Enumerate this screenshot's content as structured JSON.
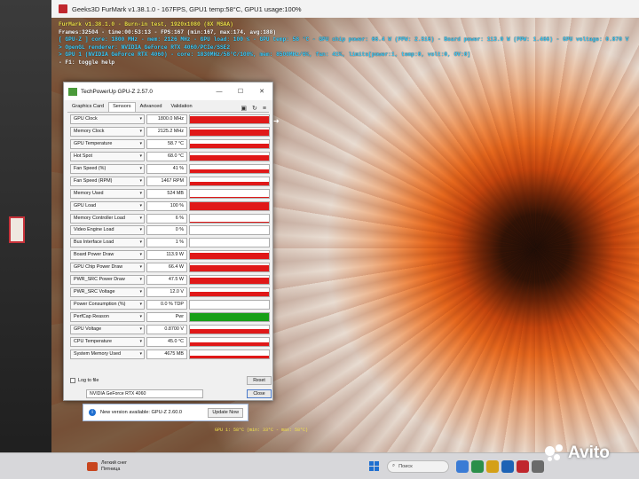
{
  "furmark_window": {
    "title": "Geeks3D FurMark v1.38.1.0 - 167FPS, GPU1 temp:58°C, GPU1 usage:100%"
  },
  "osd": {
    "lines": [
      "FurMark v1.38.1.0 - Burn-in test, 1920x1080 (8X MSAA)",
      "Frames:32504 - time:00:53:13 - FPS:167 (min:167, max:174, avg:188)",
      "[ GPU-Z ] core: 1800 MHz - mem: 2126 MHz - GPU load: 100 % - GPU temp: 58 °C - GPU chip power: 66.4 W (PPW: 2.516) - Board power: 113.9 W (PPW: 1.466) - GPU voltage: 0.870 V",
      "> OpenGL renderer: NVIDIA GeForce RTX 4060/PCIe/SSE2",
      "> GPU 1 (NVIDIA GeForce RTX 4060) - core: 1830MHz/58°C/100%, mem: 8500MHz/6%, fan: 41%, limits[power:1, temp:0, volt:0, OV:0]",
      "- F1: toggle help"
    ],
    "status": "GPU 1: 58°C (min: 33°C - max: 58°C)"
  },
  "gpuz": {
    "title": "TechPowerUp GPU-Z 2.57.0",
    "tabs": [
      "Graphics Card",
      "Sensors",
      "Advanced",
      "Validation"
    ],
    "active_tab": "Sensors",
    "sensors": [
      {
        "label": "GPU Clock",
        "value": "1800.0 MHz",
        "level": 0.85,
        "color": "#e01818"
      },
      {
        "label": "Memory Clock",
        "value": "2125.2 MHz",
        "level": 0.75,
        "color": "#e01818"
      },
      {
        "label": "GPU Temperature",
        "value": "58.7 °C",
        "level": 0.55,
        "color": "#e01818"
      },
      {
        "label": "Hot Spot",
        "value": "68.0 °C",
        "level": 0.6,
        "color": "#e01818"
      },
      {
        "label": "Fan Speed (%)",
        "value": "41 %",
        "level": 0.4,
        "color": "#e01818"
      },
      {
        "label": "Fan Speed (RPM)",
        "value": "1467 RPM",
        "level": 0.4,
        "color": "#e01818"
      },
      {
        "label": "Memory Used",
        "value": "524 MB",
        "level": 0.06,
        "color": "#e01818"
      },
      {
        "label": "GPU Load",
        "value": "100 %",
        "level": 1.0,
        "color": "#e01818"
      },
      {
        "label": "Memory Controller Load",
        "value": "6 %",
        "level": 0.08,
        "color": "#e01818"
      },
      {
        "label": "Video Engine Load",
        "value": "0 %",
        "level": 0.0,
        "color": "#e01818"
      },
      {
        "label": "Bus Interface Load",
        "value": "1 %",
        "level": 0.05,
        "color": "#e01818"
      },
      {
        "label": "Board Power Draw",
        "value": "113.9 W",
        "level": 0.85,
        "color": "#e01818"
      },
      {
        "label": "GPU Chip Power Draw",
        "value": "66.4 W",
        "level": 0.8,
        "color": "#e01818"
      },
      {
        "label": "PWR_SRC Power Draw",
        "value": "47.5 W",
        "level": 0.8,
        "color": "#e01818"
      },
      {
        "label": "PWR_SRC Voltage",
        "value": "12.0 V",
        "level": 0.6,
        "color": "#e01818"
      },
      {
        "label": "Power Consumption (%)",
        "value": "0.0 % TDP",
        "level": 0.0,
        "color": "#e01818"
      },
      {
        "label": "PerfCap Reason",
        "value": "Pwr",
        "level": 1.0,
        "color": "#18a018"
      },
      {
        "label": "GPU Voltage",
        "value": "0.8700 V",
        "level": 0.55,
        "color": "#e01818"
      },
      {
        "label": "CPU Temperature",
        "value": "45.0 °C",
        "level": 0.45,
        "color": "#e01818"
      },
      {
        "label": "System Memory Used",
        "value": "4675 MB",
        "level": 0.3,
        "color": "#e01818"
      }
    ],
    "log_label": "Log to file",
    "reset_label": "Reset",
    "gpu_select": "NVIDIA GeForce RTX 4060",
    "close_label": "Close"
  },
  "notification": {
    "message": "New version available: GPU-Z 2.60.0",
    "button": "Update Now"
  },
  "taskbar": {
    "weather_title": "Легкий снег",
    "weather_sub": "Пятница",
    "search_placeholder": "Поиск"
  },
  "watermark": "Avito"
}
